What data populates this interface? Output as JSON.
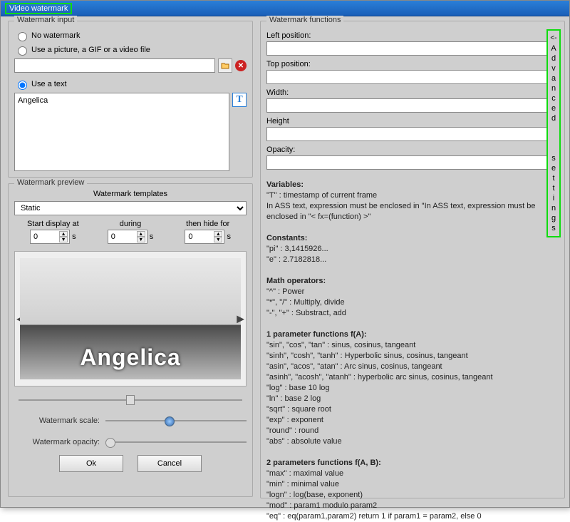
{
  "window_title": "Video watermark",
  "advanced_tab": {
    "arrow": "<-",
    "label": "Advanced settings"
  },
  "input_group": {
    "title": "Watermark input",
    "no_watermark": "No watermark",
    "use_picture": "Use a picture, a GIF or a video file",
    "use_text": "Use a text",
    "text_value": "Angelica",
    "file_value": ""
  },
  "preview_group": {
    "title": "Watermark preview",
    "templates_label": "Watermark templates",
    "template_selected": "Static",
    "start_label": "Start display at",
    "during_label": "during",
    "hide_label": "then hide for",
    "start_value": "0",
    "during_value": "0",
    "hide_value": "0",
    "unit": "s",
    "preview_text": "Angelica",
    "scale_label": "Watermark scale:",
    "opacity_label": "Watermark opacity:"
  },
  "buttons": {
    "ok": "Ok",
    "cancel": "Cancel"
  },
  "functions_group": {
    "title": "Watermark functions",
    "left": "Left position:",
    "top": "Top position:",
    "width": "Width:",
    "height": "Height",
    "opacity": "Opacity:",
    "left_val": "",
    "top_val": "",
    "width_val": "",
    "height_val": "",
    "opacity_val": ""
  },
  "help": {
    "variables_h": "Variables:",
    "variables_1": "\"T\"   : timestamp of current frame",
    "variables_2": "In ASS text, expression must be enclosed in \"In ASS text, expression must be enclosed in \"< fx=(function) >\"",
    "constants_h": "Constants:",
    "constants_1": "\"pi\"  : 3,1415926...",
    "constants_2": "\"e\"   : 2.7182818...",
    "math_h": "Math operators:",
    "math_1": "\"^\"      : Power",
    "math_2": "\"*\", \"/\" : Multiply, divide",
    "math_3": "\"-\", \"+\" : Substract, add",
    "one_h": "1 parameter functions f(A):",
    "one_1": "\"sin\", \"cos\", \"tan\"   : sinus, cosinus, tangeant",
    "one_2": "\"sinh\", \"cosh\", \"tanh\" : Hyperbolic sinus, cosinus, tangeant",
    "one_3": "\"asin\", \"acos\", \"atan\" : Arc sinus, cosinus, tangeant",
    "one_4": "\"asinh\", \"acosh\", \"atanh\" : hyperbolic arc sinus, cosinus, tangeant",
    "one_5": "\"log\"   : base 10 log",
    "one_6": "\"ln\"    : base 2 log",
    "one_7": "\"sqrt\"  : square root",
    "one_8": "\"exp\"   : exponent",
    "one_9": "\"round\" : round",
    "one_10": "\"abs\"   : absolute value",
    "two_h": "2 parameters functions f(A, B):",
    "two_1": "\"max\"  : maximal value",
    "two_2": "\"min\"  : minimal value",
    "two_3": "\"logn\" : log(base, exponent)",
    "two_4": "\"mod\"  : param1 modulo param2",
    "two_5": "\"eq\"   : eq(param1,param2) return 1 if param1 = param2, else 0"
  }
}
